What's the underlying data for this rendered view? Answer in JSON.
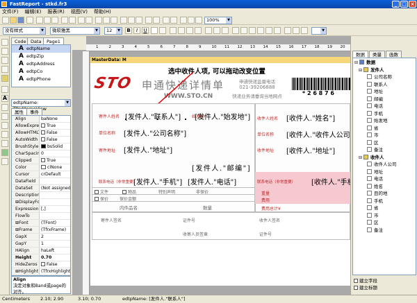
{
  "window": {
    "title": "FastReport - stkd.fr3",
    "min": "_",
    "max": "□",
    "close": "×"
  },
  "menu": [
    "文件(F)",
    "编辑(E)",
    "报表(R)",
    "视图(V)",
    "帮助(H)"
  ],
  "toolbar": {
    "style_combo": "没有样式",
    "font_combo": "微软雅黑",
    "size_combo": "12",
    "bold": "B",
    "italic": "I",
    "underline": "U",
    "zoom": "100%"
  },
  "tabs": [
    "Code",
    "Data",
    "Page1"
  ],
  "components": [
    {
      "name": "edtpName"
    },
    {
      "name": "edtpZip"
    },
    {
      "name": "edtpAddress"
    },
    {
      "name": "edtpCo"
    },
    {
      "name": "edtpPhone"
    }
  ],
  "inspector": {
    "selector": "edtpName: TfrxMemoView",
    "tab_props": "属性",
    "tab_events": "事件",
    "props": [
      {
        "k": "Align",
        "v": "baNone"
      },
      {
        "k": "AllowExpress",
        "v": "True",
        "cb": true
      },
      {
        "k": "AllowHTMLTa",
        "v": "False",
        "cb": true
      },
      {
        "k": "AutoWidth",
        "v": "False",
        "cb": true
      },
      {
        "k": "BrushStyle",
        "v": "bsSolid",
        "swatch": "#000000"
      },
      {
        "k": "CharSpacing",
        "v": "0"
      },
      {
        "k": "Clipped",
        "v": "True",
        "cb": true,
        "checked": true
      },
      {
        "k": "Color",
        "v": "clNone",
        "swatch": "#ffffff"
      },
      {
        "k": "Cursor",
        "v": "crDefault"
      },
      {
        "k": "DataField",
        "v": ""
      },
      {
        "k": "DataSet",
        "v": "(Not assigned)"
      },
      {
        "k": "Description",
        "v": ""
      },
      {
        "k": "⊞DisplayForma",
        "v": ""
      },
      {
        "k": "ExpressionDe",
        "v": "[,]"
      },
      {
        "k": "FlowTo",
        "v": ""
      },
      {
        "k": "⊞Font",
        "v": "(TFont)"
      },
      {
        "k": "⊞Frame",
        "v": "(TfrxFrame)"
      },
      {
        "k": "GapX",
        "v": "2"
      },
      {
        "k": "GapY",
        "v": "1"
      },
      {
        "k": "HAlign",
        "v": "haLeft"
      },
      {
        "k": "Height",
        "v": "0.70",
        "bold": true
      },
      {
        "k": "HideZeros",
        "v": "False",
        "cb": true
      },
      {
        "k": "⊞Highlight",
        "v": "(TfrxHighlight)"
      }
    ],
    "help_title": "Align",
    "help_text": "决定对象和Band或page的对齐。"
  },
  "canvas": {
    "band_label": "MasterData: M",
    "annotation": "选中收件人项, 可以拖动改变位置",
    "logo": "STO",
    "slogan": "申通快递详情单",
    "website": "WWW.STO.CN",
    "phone_title": "申通快递监督电话",
    "phone": "021-39206888",
    "query": "快递业务请垂询当地网点",
    "barcode_digits": "* 2 6 8 7 6",
    "sender": {
      "name": "[发件人.\"联系人\"]",
      "from": "[发件人.\"始发地\"]",
      "company": "[发件人.\"公司名称\"]",
      "address": "[发件人.\"地址\"]",
      "zip": "[发件人.\"邮编\"]",
      "phone": "[发件人.\"手机\"]",
      "tel": "[发件人.\"电话\"]"
    },
    "receiver": {
      "name": "[收件人.\"姓名\"]",
      "company": "[收件人.\"收件人公司\"]",
      "address": "[收件人.\"地址\"]",
      "phone": "[收件人.\"手机\"]"
    },
    "labels": {
      "s_name": "寄件人姓名",
      "s_from": "始发地",
      "s_company": "单位名称",
      "s_address": "寄件地址",
      "s_tel": "联系电话（非常重要）",
      "r_name": "收件人姓名",
      "r_company": "单位名称",
      "r_address": "收件地址",
      "r_tel": "联系电话（非常重要）",
      "r_dest": "目的地",
      "doc": "文件",
      "goods": "物品",
      "special": "特别声明",
      "insured": "非保价",
      "insure": "保价",
      "insure_value": "保价金额",
      "item": "内件品名",
      "qty": "数量",
      "weight": "重量",
      "fee": "费用",
      "total": "费用总计¥",
      "receiver_sign": "收件人签名",
      "sender_sign": "寄件人签名",
      "staff_sign": "收寄人员签章",
      "cert_no": "证件号"
    }
  },
  "right_panel": {
    "tabs": [
      "数据",
      "类量",
      "函数"
    ],
    "root": "数据",
    "groups": [
      {
        "name": "发件人",
        "fields": [
          "公司名称",
          "联系人",
          "地址",
          "邮编",
          "电话",
          "手机",
          "始发地",
          "省",
          "市",
          "区",
          "备注"
        ]
      },
      {
        "name": "收件人",
        "fields": [
          "收件人公司",
          "地址",
          "电话",
          "姓名",
          "目的地",
          "手机",
          "省",
          "市",
          "区",
          "备注"
        ]
      }
    ],
    "opt1": "建立字段",
    "opt2": "建立标题"
  },
  "status": {
    "unit": "Centimeters",
    "pos": "2.10; 2.90",
    "size": "3.10; 0.70",
    "info": "edtpName: [发件人.\"联系人\"]"
  },
  "ruler_marks": [
    "1",
    "2",
    "3",
    "4",
    "5",
    "6",
    "7",
    "8",
    "9",
    "10",
    "11",
    "12",
    "13",
    "14",
    "15",
    "16",
    "17",
    "18",
    "19",
    "20"
  ]
}
